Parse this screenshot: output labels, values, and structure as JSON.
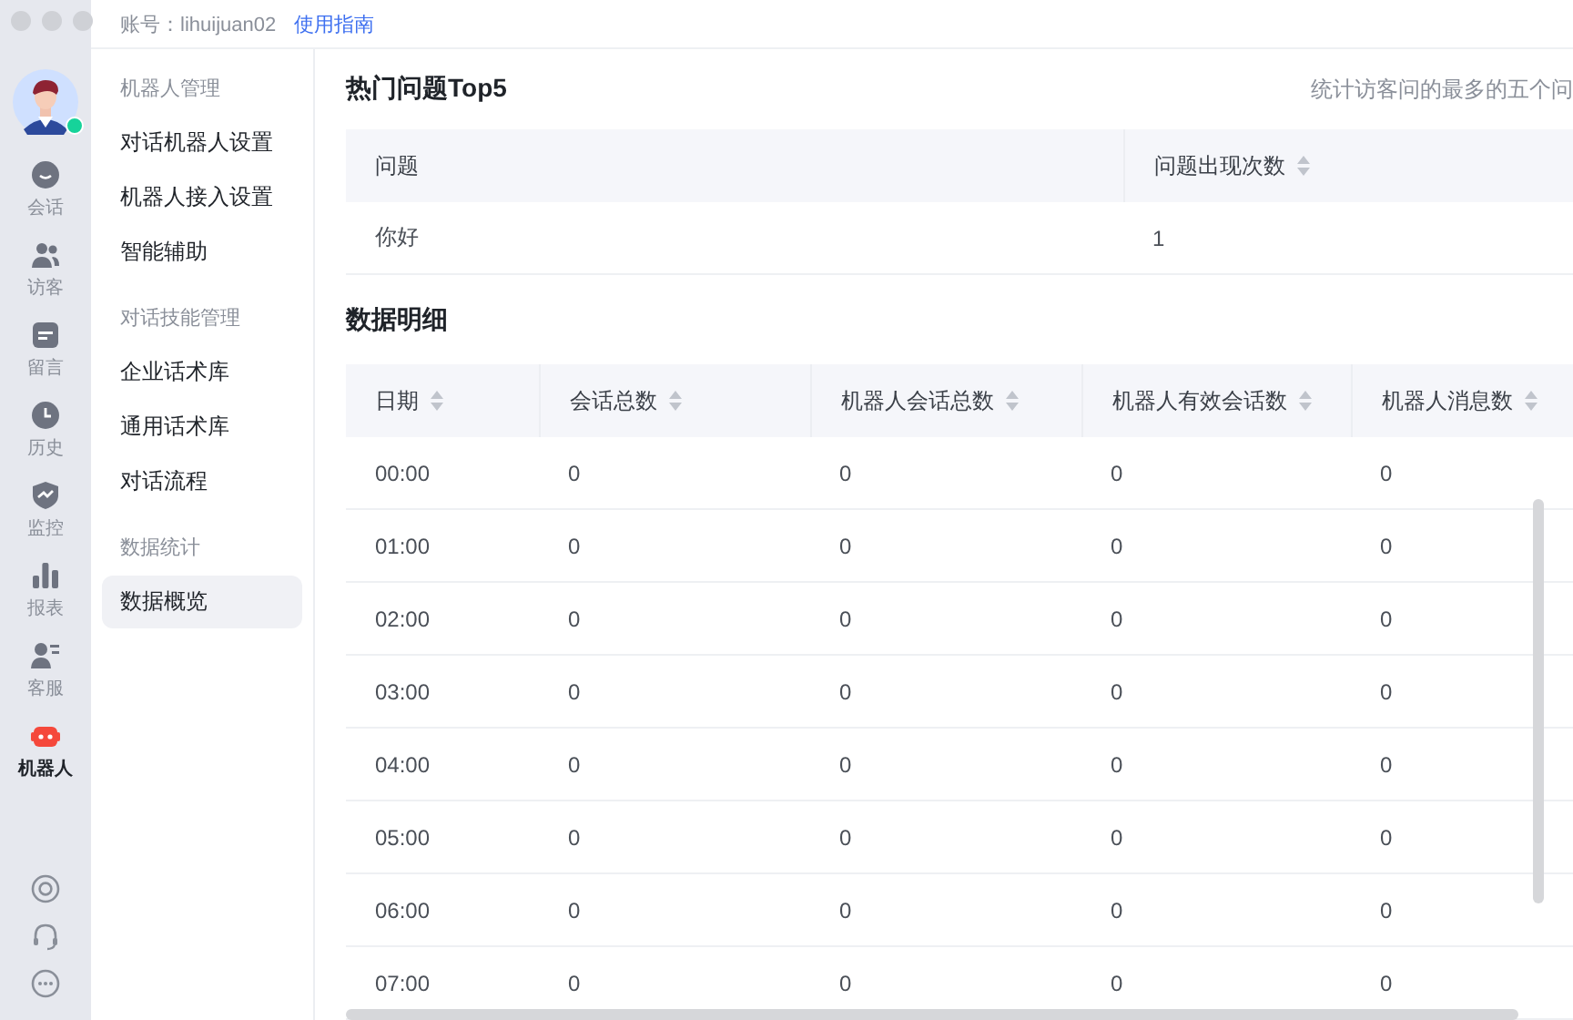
{
  "account": {
    "label": "账号：lihuijuan02",
    "link": "使用指南"
  },
  "rail": {
    "items": [
      {
        "label": "会话",
        "selected": false
      },
      {
        "label": "访客",
        "selected": false
      },
      {
        "label": "留言",
        "selected": false
      },
      {
        "label": "历史",
        "selected": false
      },
      {
        "label": "监控",
        "selected": false
      },
      {
        "label": "报表",
        "selected": false
      },
      {
        "label": "客服",
        "selected": false
      },
      {
        "label": "机器人",
        "selected": true
      }
    ]
  },
  "menu": {
    "groups": [
      {
        "title": "机器人管理",
        "items": [
          {
            "label": "对话机器人设置",
            "selected": false
          },
          {
            "label": "机器人接入设置",
            "selected": false
          },
          {
            "label": "智能辅助",
            "selected": false
          }
        ]
      },
      {
        "title": "对话技能管理",
        "items": [
          {
            "label": "企业话术库",
            "selected": false
          },
          {
            "label": "通用话术库",
            "selected": false
          },
          {
            "label": "对话流程",
            "selected": false
          }
        ]
      },
      {
        "title": "数据统计",
        "items": [
          {
            "label": "数据概览",
            "selected": true
          }
        ]
      }
    ]
  },
  "top5": {
    "title": "热门问题Top5",
    "note": "统计访客问的最多的五个问",
    "columns": [
      {
        "label": "问题",
        "sortable": false
      },
      {
        "label": "问题出现次数",
        "sortable": true
      }
    ],
    "rows": [
      [
        "你好",
        "1"
      ]
    ]
  },
  "detail": {
    "title": "数据明细",
    "columns": [
      {
        "label": "日期",
        "sortable": true
      },
      {
        "label": "会话总数",
        "sortable": true
      },
      {
        "label": "机器人会话总数",
        "sortable": true
      },
      {
        "label": "机器人有效会话数",
        "sortable": true
      },
      {
        "label": "机器人消息数",
        "sortable": true
      }
    ],
    "rows": [
      [
        "00:00",
        "0",
        "0",
        "0",
        "0"
      ],
      [
        "01:00",
        "0",
        "0",
        "0",
        "0"
      ],
      [
        "02:00",
        "0",
        "0",
        "0",
        "0"
      ],
      [
        "03:00",
        "0",
        "0",
        "0",
        "0"
      ],
      [
        "04:00",
        "0",
        "0",
        "0",
        "0"
      ],
      [
        "05:00",
        "0",
        "0",
        "0",
        "0"
      ],
      [
        "06:00",
        "0",
        "0",
        "0",
        "0"
      ],
      [
        "07:00",
        "0",
        "0",
        "0",
        "0"
      ]
    ]
  }
}
